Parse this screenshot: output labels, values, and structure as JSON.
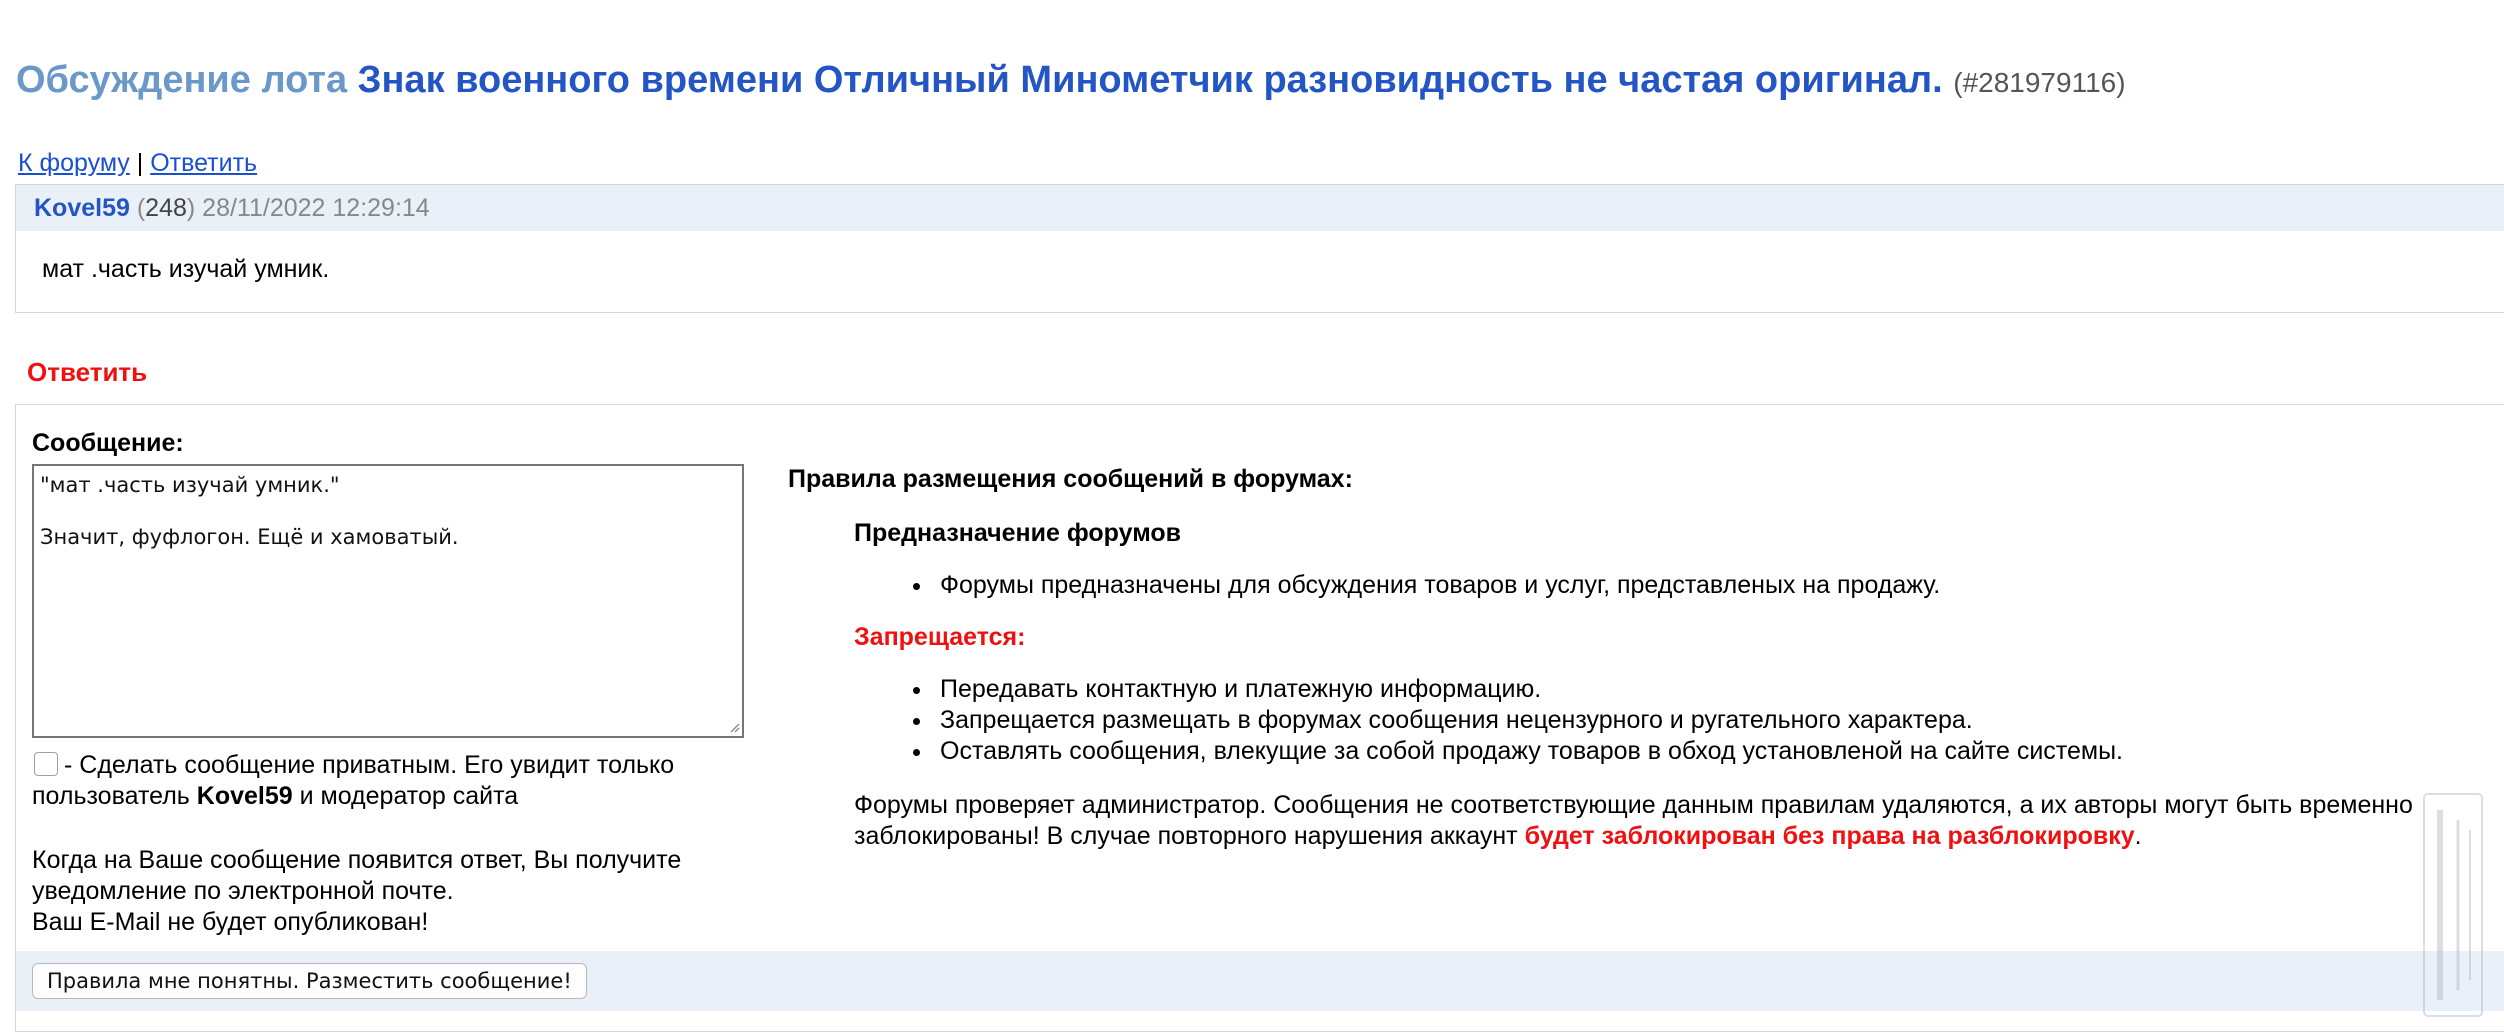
{
  "title": {
    "prefix": "Обсуждение лота",
    "lot_name": "Знак военного времени Отличный Минометчик разновидность не частая оригинал.",
    "lot_id": "(#281979116)"
  },
  "nav": {
    "forum_link": "К форуму",
    "separator": "|",
    "reply_link": "Ответить"
  },
  "post": {
    "author": "Kovel59",
    "rating_open": "(",
    "rating": "248",
    "rating_close": ")",
    "date": "28/11/2022 12:29:14",
    "text": "мат .часть изучай умник."
  },
  "reply": {
    "heading": "Ответить",
    "message_label": "Сообщение:",
    "message_value": "\"мат .часть изучай умник.\"\n\nЗначит, фуфлогон. Ещё и хамоватый.",
    "private_text_1": "- Сделать сообщение приватным. Его увидит только пользователь",
    "private_user": "Kovel59",
    "private_text_2": "и модератор сайта",
    "notify_line_1": "Когда на Ваше сообщение появится ответ, Вы получите уведомление по электронной почте.",
    "notify_line_2": "Ваш E-Mail не будет опубликован!",
    "submit_label": "Правила мне понятны. Разместить сообщение!"
  },
  "rules": {
    "title": "Правила размещения сообщений в форумах:",
    "purpose_title": "Предназначение форумов",
    "purpose_items": [
      "Форумы предназначены для обсуждения товаров и услуг, представленых на продажу."
    ],
    "forbidden_title": "Запрещается:",
    "forbidden_items": [
      "Передавать контактную и платежную информацию.",
      "Запрещается размещать в форумах сообщения нецензурного и ругательного характера.",
      "Оставлять сообщения, влекущие за собой продажу товаров в обход установленой на сайте системы."
    ],
    "admin_text": "Форумы проверяет администратор. Сообщения не соответствующие данным правилам удаляются, а их авторы могут быть временно заблокированы! В случае повторного нарушения аккаунт",
    "admin_warning": "будет заблокирован без права на разблокировку",
    "admin_end": "."
  },
  "colors": {
    "link_blue": "#1a4fd0",
    "title_blue": "#2356c4",
    "title_prefix": "#6a98c9",
    "warning_red": "#f01010",
    "panel_bg": "#eaf0f7"
  }
}
